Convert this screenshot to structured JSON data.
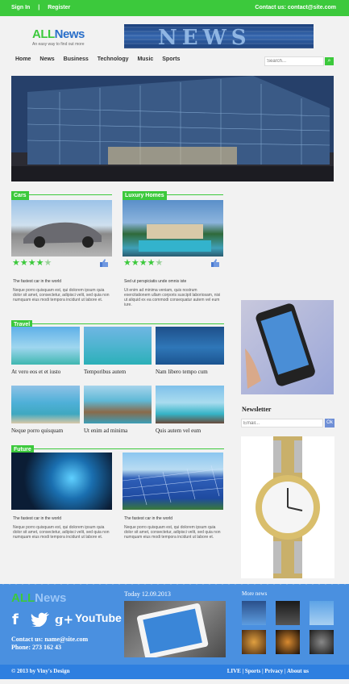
{
  "topbar": {
    "sign_in": "Sign In",
    "sep": "|",
    "register": "Register",
    "contact": "Contact us: contact@site.com"
  },
  "logo": {
    "part1": "ALL",
    "part2": "News",
    "tagline": "An easy way to find out more"
  },
  "banner": {
    "text": "NEWS"
  },
  "nav": {
    "items": [
      "Home",
      "News",
      "Business",
      "Technology",
      "Music",
      "Sports"
    ]
  },
  "search": {
    "placeholder": "Search..."
  },
  "sections": {
    "cars": {
      "label": "Cars",
      "rating": 4,
      "title": "The fastest car in the world",
      "text": "Neque porro quisquam est, qui dolorem ipsum quia dolor sit amet, consectetur, adipisci velit, sed quia non numquam eius modi tempora incidunt ut labore et."
    },
    "luxury": {
      "label": "Luxury Homes",
      "rating": 4,
      "title": "Sed ut perspiciatis unde omnis iste",
      "text": "Ut enim ad minima veniam, quis nostrum exercitationem ullam corporis suscipit laboriosam, nisi ut aliquid ex ea commodi consequatur autem vel eum iure."
    },
    "travel": {
      "label": "Travel",
      "captions": [
        "At vero eos et et iusto",
        "Temporibus autem",
        "Nam libero tempo cum",
        "Neque porro quisquam",
        "Ut enim ad minima",
        "Quis autem vel eum"
      ]
    },
    "future": {
      "label": "Future",
      "items": [
        {
          "title": "The fastest car in the world",
          "text": "Neque porro quisquam est, qui dolorem ipsum quia dolor sit amet, consectetur, adipisci velit, sed quia non numquam eius modi tempora incidunt ut labore et."
        },
        {
          "title": "The fastest car in the world",
          "text": "Neque porro quisquam est, qui dolorem ipsum quia dolor sit amet, consectetur, adipisci velit, sed quia non numquam eius modi tempora incidunt ut labore et."
        }
      ]
    }
  },
  "newsletter": {
    "title": "Newsletter",
    "placeholder": "Email...",
    "button": "Ok"
  },
  "footer": {
    "logo_part1": "ALL",
    "logo_part2": "News",
    "social": [
      "f",
      "twitter-icon",
      "g+",
      "YouTube"
    ],
    "contact_line": "Contact us: name@site.com",
    "phone_line": "Phone: 273 162 43",
    "today": "Today 12.09.2013",
    "more_news": "More news"
  },
  "bottombar": {
    "copyright": "© 2013 by Viny's Design",
    "links": "LIVE | Sports | Privacy | About us"
  },
  "colors": {
    "accent": "#3cc93c",
    "footer": "#4a90e0",
    "bottombar": "#2e7fe0"
  }
}
